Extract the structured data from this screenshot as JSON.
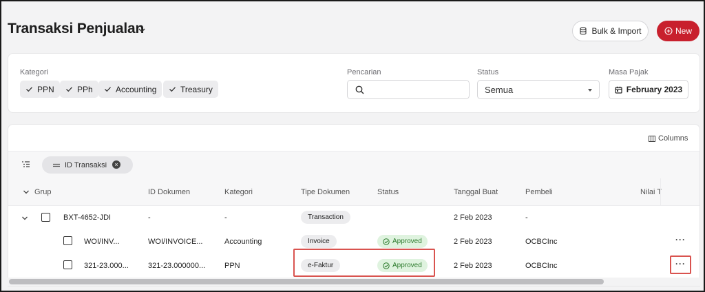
{
  "header": {
    "title": "Transaksi Penjualan",
    "bulk_import_label": "Bulk & Import",
    "new_label": "New"
  },
  "filters": {
    "kategori_label": "Kategori",
    "kategori_chips": [
      "PPN",
      "PPh",
      "Accounting",
      "Treasury"
    ],
    "pencarian_label": "Pencarian",
    "search_value": "",
    "status_label": "Status",
    "status_value": "Semua",
    "masa_pajak_label": "Masa Pajak",
    "masa_pajak_value": "February 2023"
  },
  "table": {
    "columns_label": "Columns",
    "group_chip_label": "ID Transaksi",
    "headers": {
      "grup": "Grup",
      "id_dokumen": "ID Dokumen",
      "kategori": "Kategori",
      "tipe_dokumen": "Tipe Dokumen",
      "status": "Status",
      "tanggal_buat": "Tanggal Buat",
      "pembeli": "Pembeli",
      "nilai": "Nilai T"
    },
    "group_row": {
      "grup": "BXT-4652-JDI",
      "id_dokumen": "-",
      "kategori": "-",
      "tipe_dokumen": "Transaction",
      "tanggal_buat": "2 Feb 2023",
      "pembeli": "-"
    },
    "rows": [
      {
        "grup": "WOI/INV...",
        "id_dokumen": "WOI/INVOICE...",
        "kategori": "Accounting",
        "tipe_dokumen": "Invoice",
        "status": "Approved",
        "tanggal_buat": "2 Feb 2023",
        "pembeli": "OCBCInc",
        "more": "···"
      },
      {
        "grup": "321-23.000...",
        "id_dokumen": "321-23.000000...",
        "kategori": "PPN",
        "tipe_dokumen": "e-Faktur",
        "status": "Approved",
        "tanggal_buat": "2 Feb 2023",
        "pembeli": "OCBCInc",
        "more": "···"
      }
    ]
  },
  "colors": {
    "brand_red": "#c8202d",
    "approved_bg": "#dff3df",
    "approved_text": "#2b7a2b",
    "highlight": "#d9534f"
  }
}
